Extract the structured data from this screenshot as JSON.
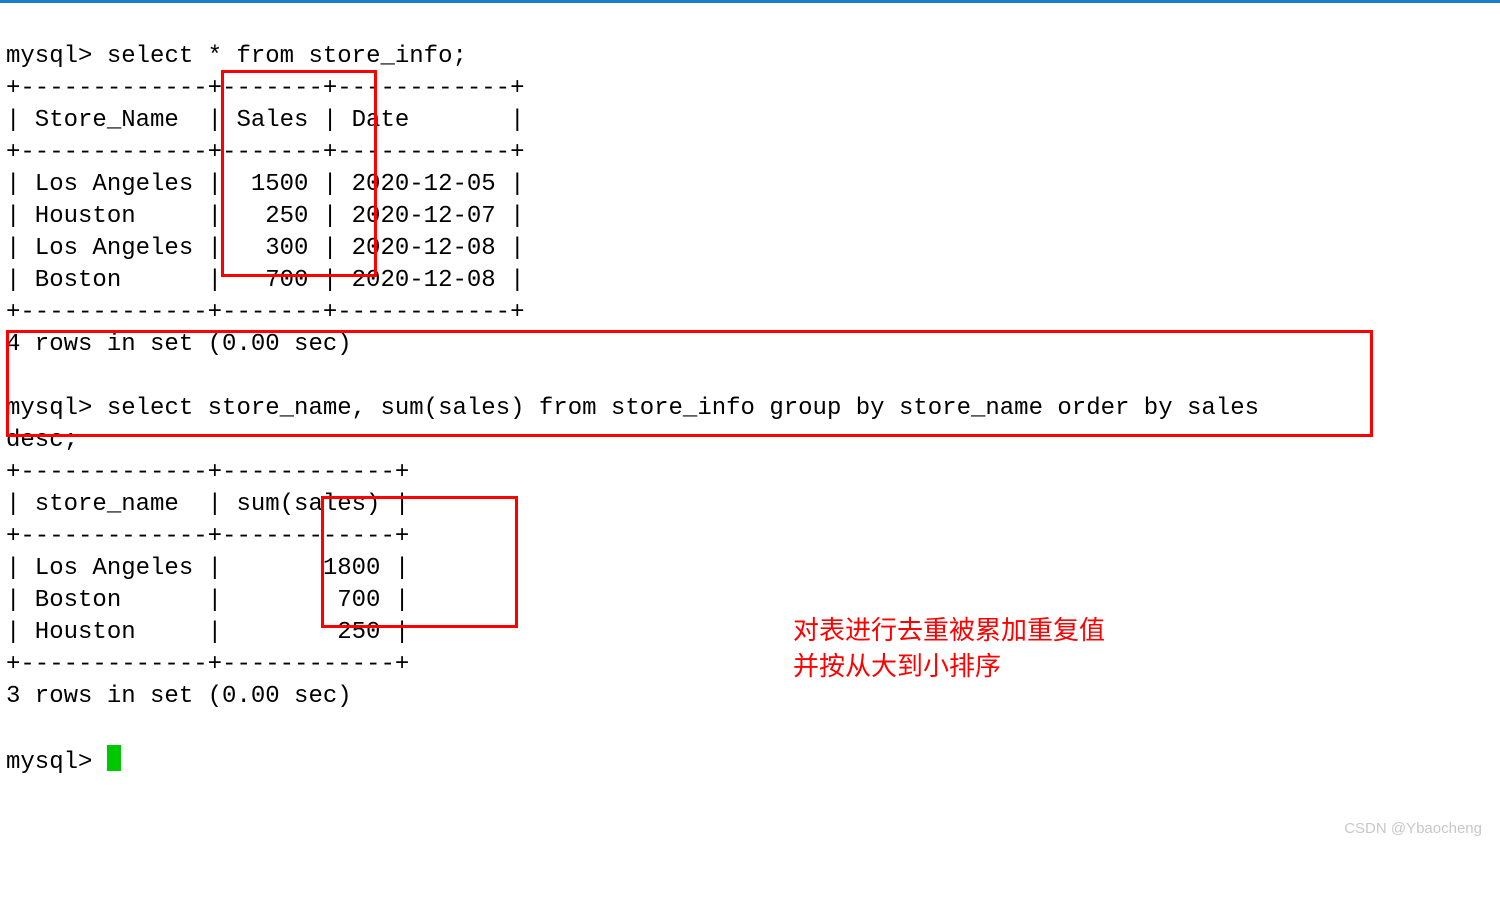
{
  "t": {
    "p1a": "mysql> ",
    "q1": "select * from store_info;",
    "b1": "+-------------+-------+------------+",
    "h1": "| Store_Name  | Sales | Date       |",
    "r1a": "| Los Angeles |  1500 | 2020-12-05 |",
    "r1b": "| Houston     |   250 | 2020-12-07 |",
    "r1c": "| Los Angeles |   300 | 2020-12-08 |",
    "r1d": "| Boston      |   700 | 2020-12-08 |",
    "res1": "4 rows in set (0.00 sec)",
    "blank": " ",
    "q2a": "select store_name, sum(sales) from store_info group by store_name order by sales",
    "q2b": "desc;",
    "b2": "+-------------+------------+",
    "h2": "| store_name  | sum(sales) |",
    "r2a": "| Los Angeles |       1800 |",
    "r2b": "| Boston      |        700 |",
    "r2c": "| Houston     |        250 |",
    "res2": "3 rows in set (0.00 sec)"
  },
  "annot": {
    "l1": "对表进行去重被累加重复值",
    "l2": "并按从大到小排序"
  },
  "wm": "CSDN @Ybaocheng",
  "chart_data": [
    {
      "type": "table",
      "title": "store_info",
      "columns": [
        "Store_Name",
        "Sales",
        "Date"
      ],
      "rows": [
        [
          "Los Angeles",
          1500,
          "2020-12-05"
        ],
        [
          "Houston",
          250,
          "2020-12-07"
        ],
        [
          "Los Angeles",
          300,
          "2020-12-08"
        ],
        [
          "Boston",
          700,
          "2020-12-08"
        ]
      ],
      "footer": "4 rows in set (0.00 sec)"
    },
    {
      "type": "table",
      "title": "select store_name, sum(sales) from store_info group by store_name order by sales desc;",
      "columns": [
        "store_name",
        "sum(sales)"
      ],
      "rows": [
        [
          "Los Angeles",
          1800
        ],
        [
          "Boston",
          700
        ],
        [
          "Houston",
          250
        ]
      ],
      "footer": "3 rows in set (0.00 sec)"
    }
  ]
}
